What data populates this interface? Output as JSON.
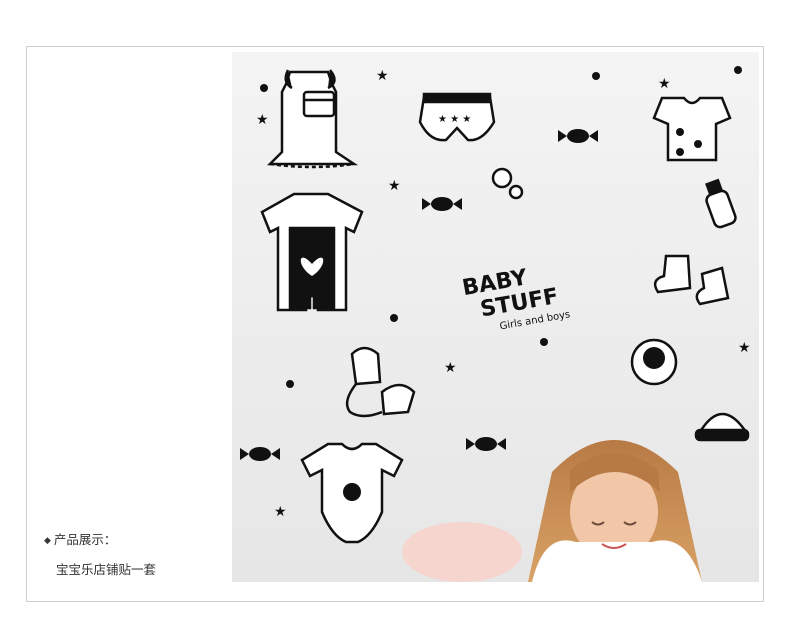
{
  "caption": {
    "bullet": "◆",
    "heading": "产品展示：",
    "description": "宝宝乐店铺贴一套"
  },
  "decal": {
    "title_line1": "BABY",
    "title_line2": "STUFF",
    "subtitle": "Girls and boys"
  },
  "colors": {
    "decal": "#111111",
    "wall": "#efefef",
    "frame": "#cfcfcf",
    "hair": "#c8834a",
    "skin": "#f2c7a8"
  }
}
